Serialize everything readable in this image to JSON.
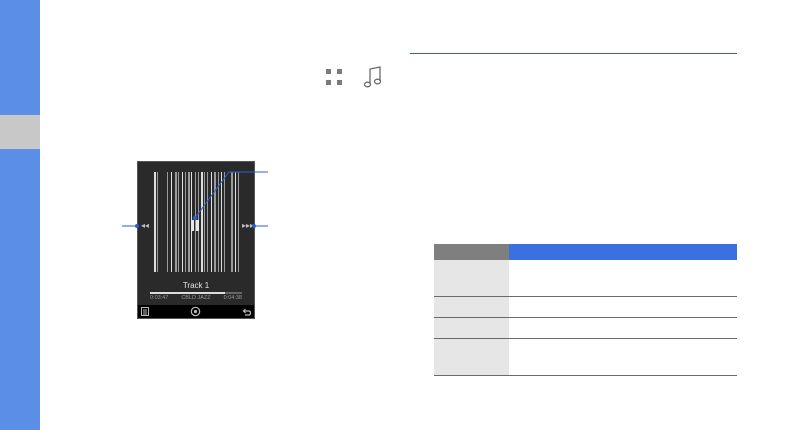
{
  "sidebar": {
    "accent": "#5b8ee6",
    "tab_color": "#c8c8c8"
  },
  "header_icons": [
    {
      "icon": "grid-icon"
    },
    {
      "icon": "music-note-icon"
    }
  ],
  "player": {
    "track_name": "Track 1",
    "elapsed_time": "0:03:47",
    "total_time": "0:04:38",
    "genre": "JAZZ",
    "format": "CBLD",
    "progress": 0.82,
    "controls": [
      "rewind-icon",
      "pause-icon",
      "fast-forward-icon"
    ],
    "bottom_bar": [
      "playlist-icon",
      "settings-icon",
      "back-icon"
    ]
  },
  "table": {
    "header_colors": [
      "#7f7f7f",
      "#3a70e0"
    ],
    "rows": [
      {
        "label": "",
        "value": ""
      },
      {
        "label": "",
        "value": ""
      },
      {
        "label": "",
        "value": ""
      },
      {
        "label": "",
        "value": ""
      }
    ]
  }
}
